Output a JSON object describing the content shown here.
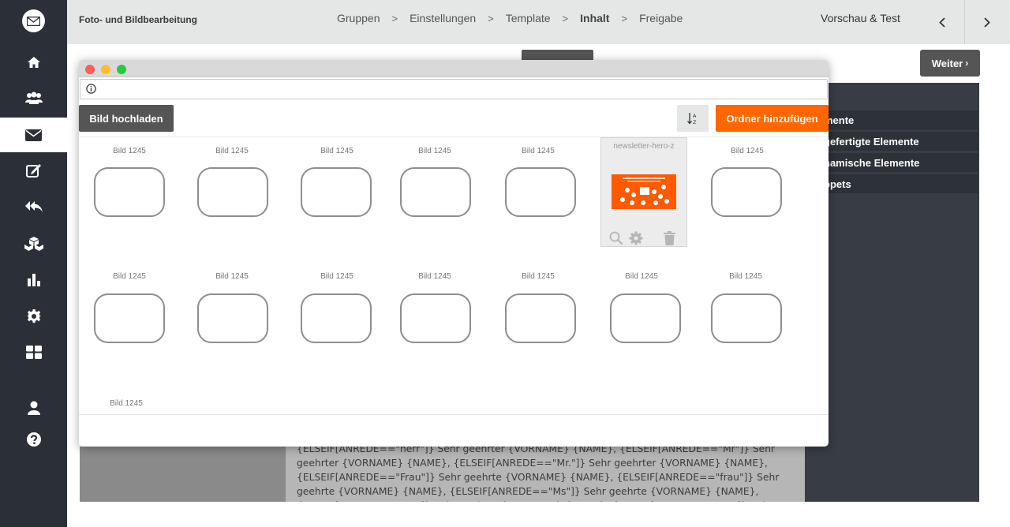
{
  "topbar": {
    "app_title": "Foto- und Bildbearbeitung",
    "steps": [
      {
        "label": "Gruppen"
      },
      {
        "label": "Einstellungen"
      },
      {
        "label": "Template"
      },
      {
        "label": "Inhalt",
        "current": true
      },
      {
        "label": "Freigabe"
      }
    ],
    "preview_label": "Vorschau & Test",
    "prev_icon": "chevron-left-icon",
    "next_icon": "chevron-right-icon"
  },
  "sidebar": {
    "items": [
      {
        "icon": "home-icon"
      },
      {
        "icon": "users-icon"
      },
      {
        "icon": "mail-icon",
        "active": true
      },
      {
        "icon": "edit-icon"
      },
      {
        "icon": "reply-icon"
      },
      {
        "icon": "cubes-icon"
      },
      {
        "icon": "bar-chart-icon"
      },
      {
        "icon": "gear-icon"
      },
      {
        "icon": "grid-icon"
      },
      {
        "icon": "user-icon"
      },
      {
        "icon": "help-icon"
      }
    ]
  },
  "background": {
    "weiter_label": "Weiter",
    "panel_items": [
      "Elemente",
      "Vorgefertigte Elemente",
      "Dynamische Elemente",
      "Snippets"
    ],
    "panel_items_visible": [
      "mente",
      "gefertigte Elemente",
      "namische Elemente",
      "ppets"
    ],
    "editor_text": "{ELSEIF[ANREDE==\"herr\"]} Sehr geehrter {VORNAME} {NAME}, {ELSEIF[ANREDE==\"Mr\"]} Sehr geehrter {VORNAME} {NAME}, {ELSEIF[ANREDE==\"Mr.\"]} Sehr geehrter {VORNAME} {NAME}, {ELSEIF[ANREDE==\"Frau\"]} Sehr geehrte {VORNAME} {NAME}, {ELSEIF[ANREDE==\"frau\"]} Sehr geehrte {VORNAME} {NAME}, {ELSEIF[ANREDE==\"Ms\"]} Sehr geehrte {VORNAME} {NAME}, {ELSEIF[ANREDE==\"Ms.\"]} Sehr geehrte {VORNAME} {NAME}, {ELSEIF[ANREDE==\"Mrs\"]} Sehr geehrte"
  },
  "modal": {
    "upload_label": "Bild hochladen",
    "add_folder_label": "Ordner hinzufügen",
    "sort_icon": "sort-alpha-icon",
    "colors": {
      "accent": "#ff6600",
      "dark_button": "#555555"
    },
    "folders_row1": [
      "Bild 1245",
      "Bild 1245",
      "Bild 1245",
      "Bild 1245",
      "Bild 1245",
      "Bild 1245"
    ],
    "folders_row2": [
      "Bild 1245",
      "Bild 1245",
      "Bild 1245",
      "Bild 1245",
      "Bild 1245",
      "Bild 1245",
      "Bild 1245"
    ],
    "folders_row3": [
      "Bild 1245"
    ],
    "image_tile": {
      "name": "newsletter-hero-z",
      "actions": [
        "zoom-icon",
        "gear-icon",
        "trash-icon"
      ]
    }
  }
}
